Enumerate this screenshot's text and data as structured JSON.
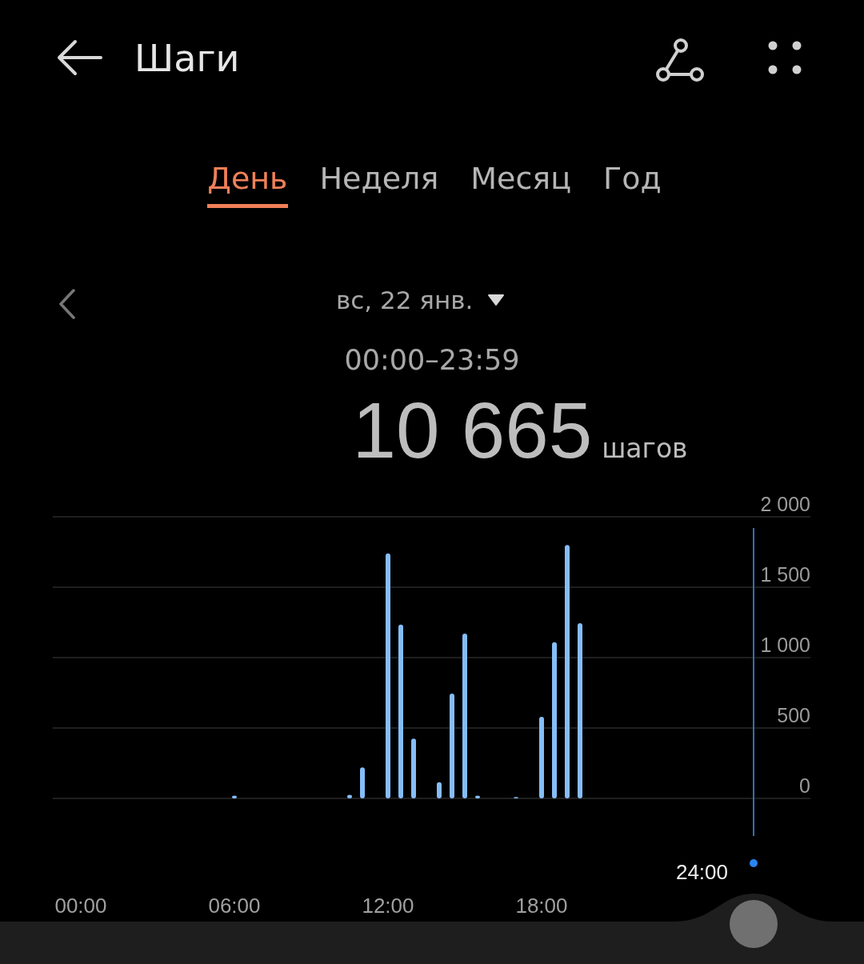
{
  "header": {
    "title": "Шаги"
  },
  "tabs": [
    {
      "label": "День",
      "selected": true
    },
    {
      "label": "Неделя",
      "selected": false
    },
    {
      "label": "Месяц",
      "selected": false
    },
    {
      "label": "Год",
      "selected": false
    }
  ],
  "date": {
    "label": "вс, 22 янв."
  },
  "time_range": "00:00–23:59",
  "total": {
    "value": "10 665",
    "unit": "шагов"
  },
  "chart": {
    "cursor_label": "24:00",
    "chart_data": {
      "type": "bar",
      "x": [
        6,
        10.5,
        11,
        12,
        12.5,
        13,
        14,
        14.5,
        15,
        15.5,
        17,
        18,
        18.5,
        19,
        19.5
      ],
      "values": [
        20,
        25,
        220,
        1740,
        1235,
        425,
        115,
        745,
        1170,
        20,
        10,
        580,
        1110,
        1800,
        1245
      ],
      "xlim": [
        -1.1,
        28.5
      ],
      "ylim": [
        0,
        2000
      ],
      "grid": true,
      "xticks": [
        {
          "value": 0,
          "label": "00:00"
        },
        {
          "value": 6,
          "label": "06:00"
        },
        {
          "value": 12,
          "label": "12:00"
        },
        {
          "value": 18,
          "label": "18:00"
        }
      ],
      "yticks": [
        {
          "value": 0,
          "label": "0"
        },
        {
          "value": 500,
          "label": "500"
        },
        {
          "value": 1000,
          "label": "1 000"
        },
        {
          "value": 1500,
          "label": "1 500"
        },
        {
          "value": 2000,
          "label": "2 000"
        }
      ]
    }
  }
}
